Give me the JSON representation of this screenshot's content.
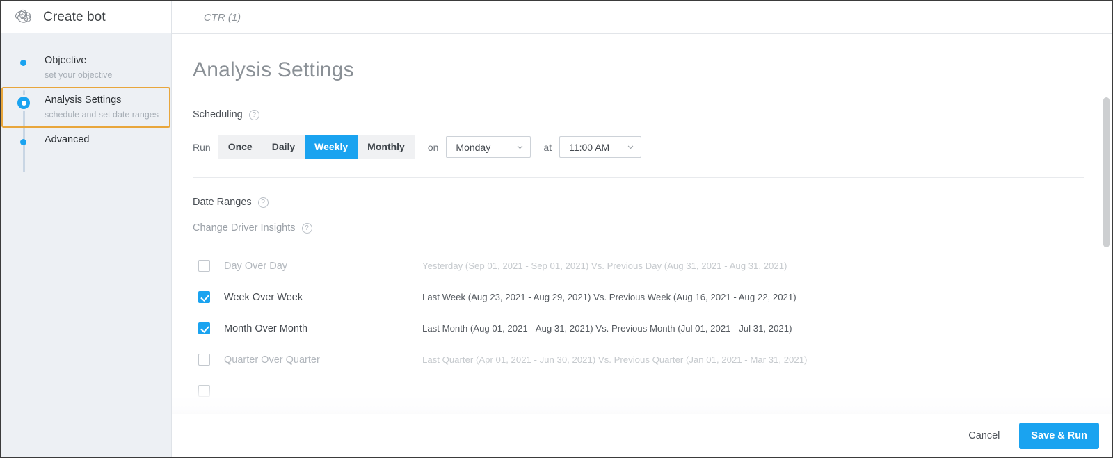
{
  "brand": {
    "title": "Create bot",
    "logo_icon": "knot-logo-icon"
  },
  "sidebar": {
    "steps": [
      {
        "label": "Objective",
        "sub": "set your objective",
        "active": false
      },
      {
        "label": "Analysis Settings",
        "sub": "schedule and set date ranges",
        "active": true
      },
      {
        "label": "Advanced",
        "sub": "",
        "active": false
      }
    ]
  },
  "tabs": [
    {
      "label": "CTR (1)"
    }
  ],
  "main": {
    "page_title": "Analysis Settings",
    "scheduling": {
      "heading": "Scheduling",
      "help_glyph": "?",
      "run_label": "Run",
      "frequencies": [
        {
          "label": "Once",
          "selected": false
        },
        {
          "label": "Daily",
          "selected": false
        },
        {
          "label": "Weekly",
          "selected": true
        },
        {
          "label": "Monthly",
          "selected": false
        }
      ],
      "on_label": "on",
      "day_value": "Monday",
      "at_label": "at",
      "time_value": "11:00 AM"
    },
    "date_ranges": {
      "heading": "Date Ranges",
      "sub_heading": "Change Driver Insights",
      "rows": [
        {
          "name": "Day Over Day",
          "dates": "Yesterday (Sep 01, 2021 - Sep 01, 2021) Vs. Previous Day (Aug 31, 2021 - Aug 31, 2021)",
          "checked": false,
          "dim": true
        },
        {
          "name": "Week Over Week",
          "dates": "Last Week (Aug 23, 2021 - Aug 29, 2021) Vs. Previous Week (Aug 16, 2021 - Aug 22, 2021)",
          "checked": true,
          "dim": false
        },
        {
          "name": "Month Over Month",
          "dates": "Last Month (Aug 01, 2021 - Aug 31, 2021) Vs. Previous Month (Jul 01, 2021 - Jul 31, 2021)",
          "checked": true,
          "dim": false
        },
        {
          "name": "Quarter Over Quarter",
          "dates": "Last Quarter (Apr 01, 2021 - Jun 30, 2021) Vs. Previous Quarter (Jan 01, 2021 - Mar 31, 2021)",
          "checked": false,
          "dim": true
        },
        {
          "name": "",
          "dates": "",
          "checked": false,
          "dim": true
        }
      ]
    }
  },
  "footer": {
    "cancel_label": "Cancel",
    "save_label": "Save & Run"
  },
  "colors": {
    "accent": "#1aa3f0",
    "active_step_border": "#e8a63c",
    "sidebar_bg": "#edf0f4",
    "muted_text": "#b3b8be"
  }
}
